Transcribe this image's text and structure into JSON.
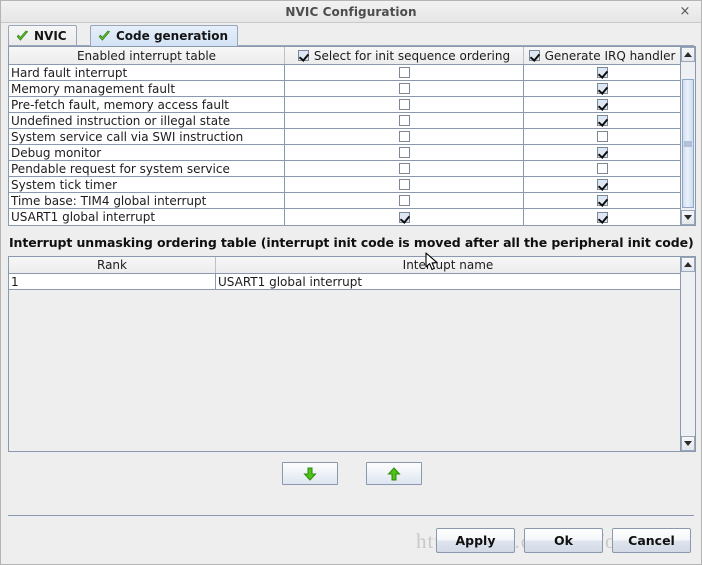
{
  "window": {
    "title": "NVIC Configuration",
    "close_label": "×"
  },
  "tabs": [
    {
      "label": "NVIC",
      "icon": "green-check-icon",
      "active": false
    },
    {
      "label": "Code generation",
      "icon": "green-check-icon",
      "active": true
    }
  ],
  "interrupt_table": {
    "headers": {
      "name": "Enabled interrupt table",
      "select_ordering": "Select for init sequence ordering",
      "generate_irq": "Generate IRQ handler",
      "select_ordering_checked": true,
      "generate_irq_checked": true
    },
    "rows": [
      {
        "name": "Hard fault interrupt",
        "select_ordering": false,
        "generate_irq": true
      },
      {
        "name": "Memory management fault",
        "select_ordering": false,
        "generate_irq": true
      },
      {
        "name": "Pre-fetch fault, memory access fault",
        "select_ordering": false,
        "generate_irq": true
      },
      {
        "name": "Undefined instruction or illegal state",
        "select_ordering": false,
        "generate_irq": true
      },
      {
        "name": "System service call via SWI instruction",
        "select_ordering": false,
        "generate_irq": false
      },
      {
        "name": "Debug monitor",
        "select_ordering": false,
        "generate_irq": true
      },
      {
        "name": "Pendable request for system service",
        "select_ordering": false,
        "generate_irq": false
      },
      {
        "name": "System tick timer",
        "select_ordering": false,
        "generate_irq": true
      },
      {
        "name": "Time base: TIM4 global interrupt",
        "select_ordering": false,
        "generate_irq": true
      },
      {
        "name": "USART1 global interrupt",
        "select_ordering": true,
        "generate_irq": true
      }
    ]
  },
  "ordering_section": {
    "title": "Interrupt unmasking ordering table (interrupt init code is moved after all the peripheral init code)",
    "headers": {
      "rank": "Rank",
      "name": "Interrupt name"
    },
    "rows": [
      {
        "rank": "1",
        "name": "USART1 global interrupt"
      }
    ]
  },
  "move_buttons": [
    {
      "name": "move-down-button",
      "icon": "green-down-arrow-icon"
    },
    {
      "name": "move-up-button",
      "icon": "green-up-arrow-icon"
    }
  ],
  "dialog_buttons": [
    {
      "label": "Apply"
    },
    {
      "label": "Ok"
    },
    {
      "label": "Cancel"
    }
  ],
  "watermark": {
    "text": "http://blog.csdn.net/ouening"
  },
  "colors": {
    "accent": "#3a6ea5",
    "panel_bg": "#eeeeee",
    "table_bg": "#ffffff",
    "border": "#8a99ad",
    "checkmark_green": "#5fbf2f",
    "title_text": "#4d4d4d"
  }
}
